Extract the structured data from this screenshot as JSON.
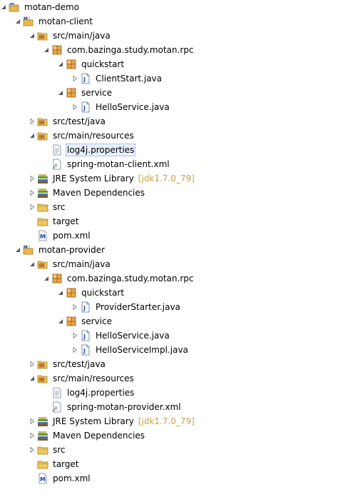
{
  "tree": [
    {
      "label": "motan-demo",
      "level": 0,
      "arrow": "expanded",
      "icon": "project-folder-icon"
    },
    {
      "label": "motan-client",
      "level": 1,
      "arrow": "expanded",
      "icon": "maven-project-icon"
    },
    {
      "label": "src/main/java",
      "level": 2,
      "arrow": "expanded",
      "icon": "source-folder-icon"
    },
    {
      "label": "com.bazinga.study.motan.rpc",
      "level": 3,
      "arrow": "expanded",
      "icon": "package-icon"
    },
    {
      "label": "quickstart",
      "level": 4,
      "arrow": "expanded",
      "icon": "package-icon"
    },
    {
      "label": "ClientStart.java",
      "level": 5,
      "arrow": "collapsed",
      "icon": "java-file-icon"
    },
    {
      "label": "service",
      "level": 4,
      "arrow": "expanded",
      "icon": "package-icon"
    },
    {
      "label": "HelloService.java",
      "level": 5,
      "arrow": "collapsed",
      "icon": "java-file-icon"
    },
    {
      "label": "src/test/java",
      "level": 2,
      "arrow": "collapsed",
      "icon": "source-folder-icon"
    },
    {
      "label": "src/main/resources",
      "level": 2,
      "arrow": "expanded",
      "icon": "source-folder-icon"
    },
    {
      "label": "log4j.properties",
      "level": 3,
      "arrow": "none",
      "icon": "properties-file-icon",
      "selected": true
    },
    {
      "label": "spring-motan-client.xml",
      "level": 3,
      "arrow": "none",
      "icon": "xml-file-icon"
    },
    {
      "label": "JRE System Library",
      "suffix": "[jdk1.7.0_79]",
      "level": 2,
      "arrow": "collapsed",
      "icon": "library-icon"
    },
    {
      "label": "Maven Dependencies",
      "level": 2,
      "arrow": "collapsed",
      "icon": "library-icon"
    },
    {
      "label": "src",
      "level": 2,
      "arrow": "collapsed",
      "icon": "folder-icon"
    },
    {
      "label": "target",
      "level": 2,
      "arrow": "none",
      "icon": "folder-icon"
    },
    {
      "label": "pom.xml",
      "level": 2,
      "arrow": "none",
      "icon": "maven-pom-icon"
    },
    {
      "label": "motan-provider",
      "level": 1,
      "arrow": "expanded",
      "icon": "maven-project-icon"
    },
    {
      "label": "src/main/java",
      "level": 2,
      "arrow": "expanded",
      "icon": "source-folder-icon"
    },
    {
      "label": "com.bazinga.study.motan.rpc",
      "level": 3,
      "arrow": "expanded",
      "icon": "package-icon"
    },
    {
      "label": "quickstart",
      "level": 4,
      "arrow": "expanded",
      "icon": "package-icon"
    },
    {
      "label": "ProviderStarter.java",
      "level": 5,
      "arrow": "collapsed",
      "icon": "java-file-icon"
    },
    {
      "label": "service",
      "level": 4,
      "arrow": "expanded",
      "icon": "package-icon"
    },
    {
      "label": "HelloService.java",
      "level": 5,
      "arrow": "collapsed",
      "icon": "java-file-icon"
    },
    {
      "label": "HelloServiceImpl.java",
      "level": 5,
      "arrow": "collapsed",
      "icon": "java-file-icon"
    },
    {
      "label": "src/test/java",
      "level": 2,
      "arrow": "collapsed",
      "icon": "source-folder-icon"
    },
    {
      "label": "src/main/resources",
      "level": 2,
      "arrow": "expanded",
      "icon": "source-folder-icon"
    },
    {
      "label": "log4j.properties",
      "level": 3,
      "arrow": "none",
      "icon": "properties-file-icon"
    },
    {
      "label": "spring-motan-provider.xml",
      "level": 3,
      "arrow": "none",
      "icon": "xml-file-icon"
    },
    {
      "label": "JRE System Library",
      "suffix": "[jdk1.7.0_79]",
      "level": 2,
      "arrow": "collapsed",
      "icon": "library-icon"
    },
    {
      "label": "Maven Dependencies",
      "level": 2,
      "arrow": "collapsed",
      "icon": "library-icon"
    },
    {
      "label": "src",
      "level": 2,
      "arrow": "collapsed",
      "icon": "folder-icon"
    },
    {
      "label": "target",
      "level": 2,
      "arrow": "none",
      "icon": "folder-icon"
    },
    {
      "label": "pom.xml",
      "level": 2,
      "arrow": "none",
      "icon": "maven-pom-icon"
    }
  ]
}
